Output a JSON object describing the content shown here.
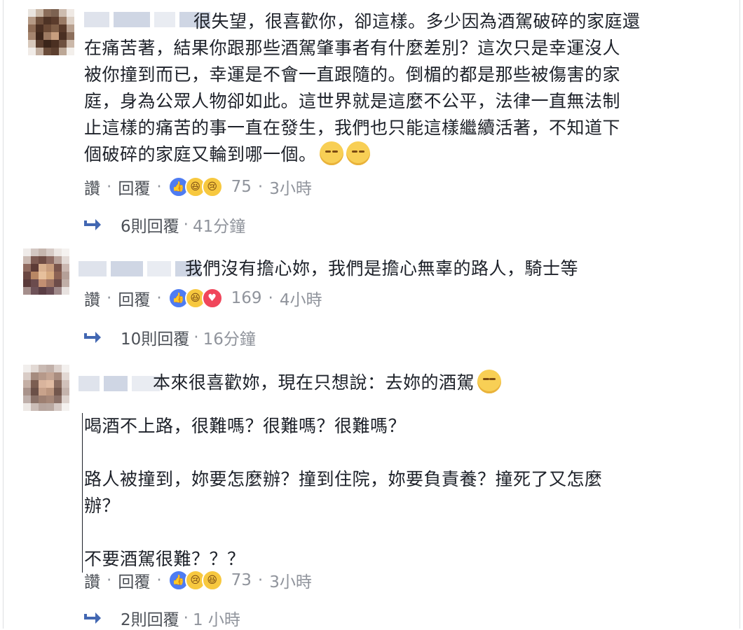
{
  "comments": [
    {
      "text": "很失望，很喜歡你，卻這樣。多少因為酒駕破碎的家庭還\n在痛苦著，結果你跟那些酒駕肇事者有什麼差別？這次只是幸運沒人\n被你撞到而已，幸運是不會一直跟隨的。倒楣的都是那些被傷害的家\n庭，身為公眾人物卻如此。這世界就是這麼不公平，法律一直無法制\n止這樣的痛苦的事一直在發生，我們也只能這樣繼續活著，不知道下\n個破碎的家庭又輪到哪一個。",
      "trailing_emojis": [
        "relieved-face-emoji",
        "relieved-face-emoji"
      ],
      "like_label": "讚",
      "reply_label": "回覆",
      "reactions": [
        "like-icon",
        "haha-icon",
        "sad-icon"
      ],
      "reaction_count": "75",
      "time": "3小時",
      "replies_label": "6則回覆",
      "replies_time": "41分鐘"
    },
    {
      "text": "我們沒有擔心妳，我們是擔心無辜的路人，騎士等",
      "like_label": "讚",
      "reply_label": "回覆",
      "reactions": [
        "like-icon",
        "haha-icon",
        "love-icon"
      ],
      "reaction_count": "169",
      "time": "4小時",
      "replies_label": "10則回覆",
      "replies_time": "16分鐘"
    },
    {
      "text_first_line": "本來很喜歡妳，現在只想說：去妳的酒駕",
      "first_line_emoji": "unamused-face-emoji",
      "text_body": "喝酒不上路，很難嗎？很難嗎？很難嗎？\n\n路人被撞到，妳要怎麼辦？撞到住院，妳要負責養？撞死了又怎麼\n辦？\n\n不要酒駕很難？？？",
      "like_label": "讚",
      "reply_label": "回覆",
      "reactions": [
        "like-icon",
        "haha-icon",
        "haha-icon"
      ],
      "reaction_count": "73",
      "time": "3小時",
      "replies_label": "2則回覆",
      "replies_time": "1 小時"
    }
  ],
  "colors": {
    "text": "#1d2129",
    "meta": "#90949c",
    "link": "#4b4f56",
    "like": "#4e7cf2",
    "reply_arrow": "#4267b2"
  }
}
